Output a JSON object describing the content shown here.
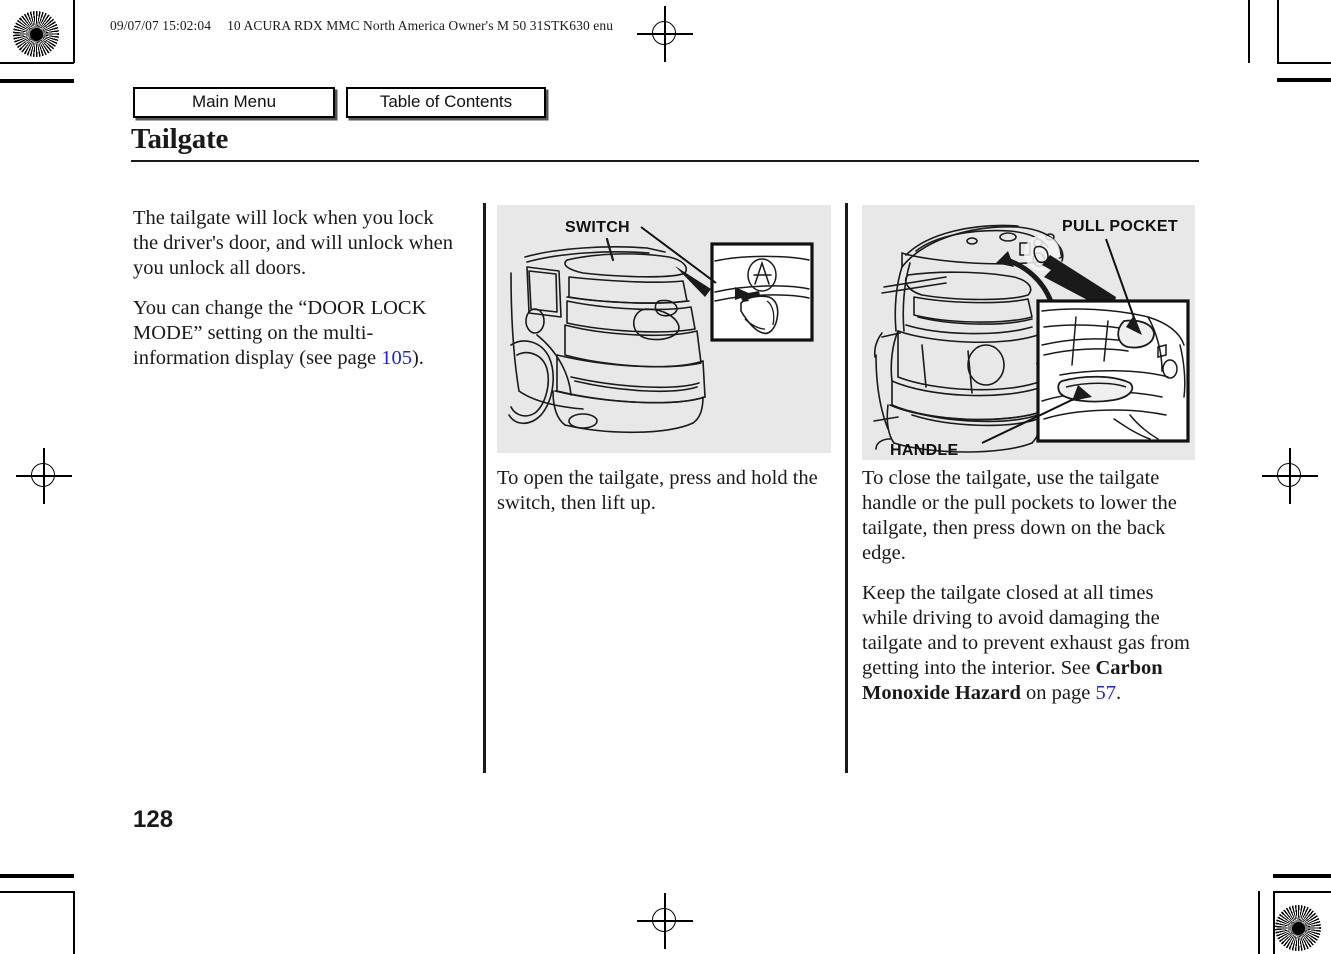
{
  "header": {
    "timestamp": "09/07/07 15:02:04",
    "doc_id": "10 ACURA RDX MMC North America Owner's M 50 31STK630 enu"
  },
  "nav": {
    "main_menu_label": "Main Menu",
    "table_of_contents_label": "Table of Contents"
  },
  "page": {
    "title": "Tailgate",
    "number": "128"
  },
  "columns": {
    "left": {
      "paragraph_1": "The tailgate will lock when you lock the driver's door, and will unlock when you unlock all doors.",
      "paragraph_2_part_1": "You can change the “DOOR LOCK MODE” setting on the multi-information display (see page ",
      "paragraph_2_pageref": "105",
      "paragraph_2_part_2": ")."
    },
    "middle": {
      "caption": "To open the tailgate, press and hold the switch, then lift up."
    },
    "right": {
      "paragraph_1": "To close the tailgate, use the tailgate handle or the pull pockets to lower the tailgate, then press down on the back edge.",
      "paragraph_2_part_1": "Keep the tailgate closed at all times while driving to avoid damaging the tailgate and to prevent exhaust gas from getting into the interior. See ",
      "paragraph_2_bold": "Carbon Monoxide Hazard",
      "paragraph_2_part_2": " on page ",
      "paragraph_2_pageref": "57",
      "paragraph_2_part_3": "."
    }
  },
  "illustrations": {
    "middle": {
      "name": "rear-view-tailgate-switch-illustration",
      "callout_switch": "SWITCH"
    },
    "right": {
      "name": "open-tailgate-handle-illustration",
      "callout_pull_pocket": "PULL POCKET",
      "callout_handle": "HANDLE"
    }
  },
  "colors": {
    "illustration_background": "#e8e8e8",
    "page_reference_link": "#2222dd",
    "text": "#1a1a1a"
  }
}
